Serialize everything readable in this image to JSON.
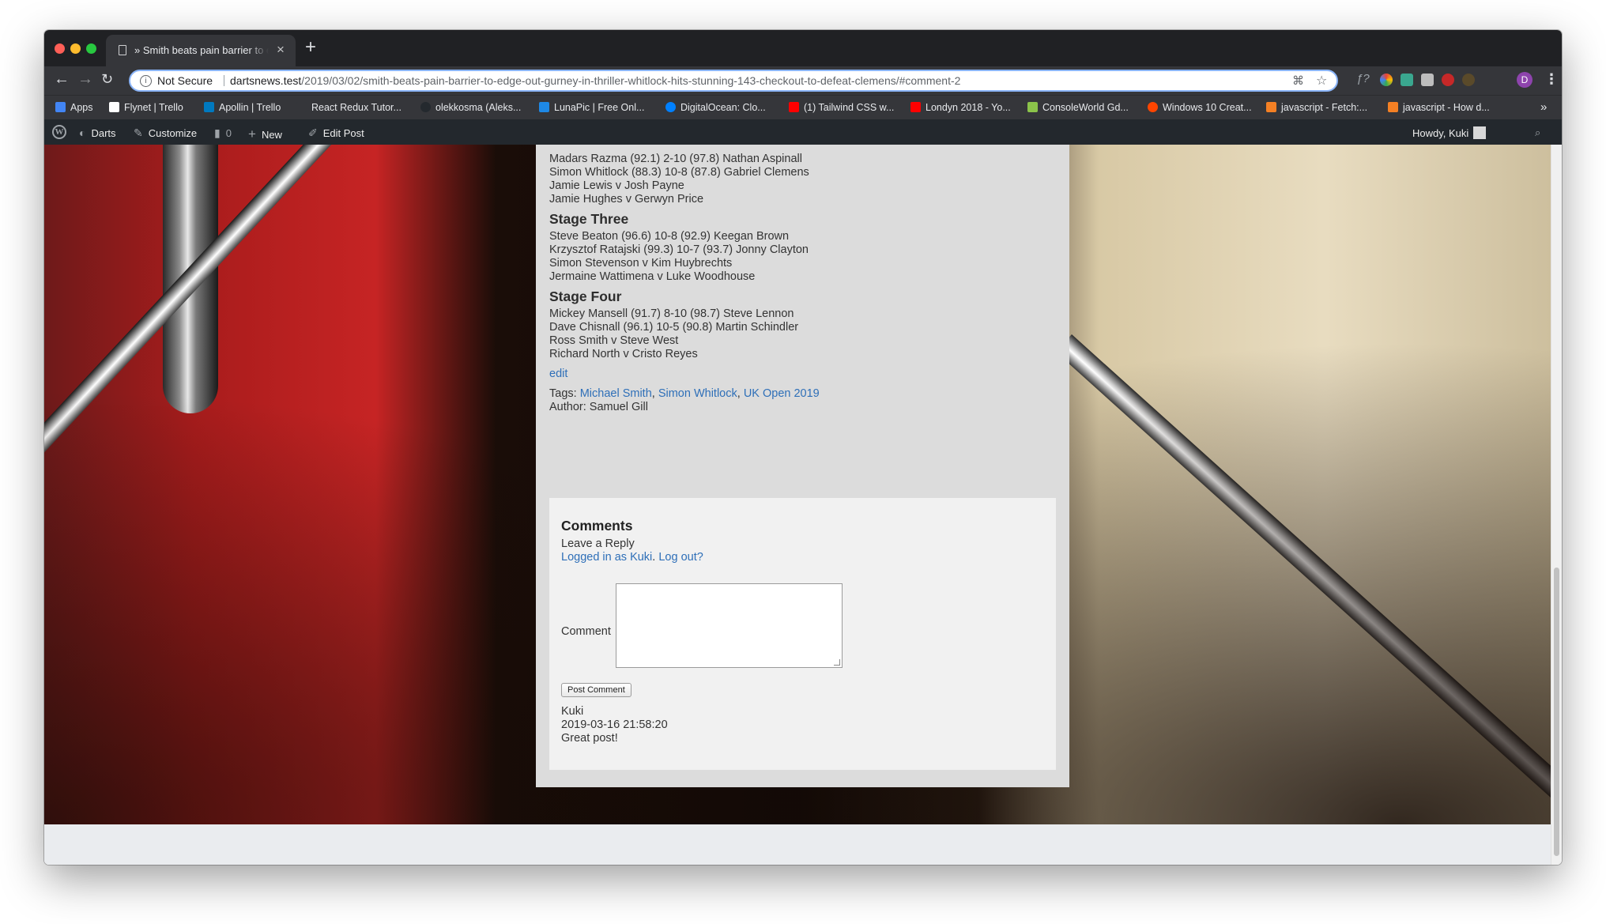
{
  "browser": {
    "tab_title": "» Smith beats pain barrier to edge out Gurney in thriller",
    "new_tab_icon": "+",
    "security_label": "Not Secure",
    "url_host": "dartsnews.test",
    "url_path": "/2019/03/02/smith-beats-pain-barrier-to-edge-out-gurney-in-thriller-whitlock-hits-stunning-143-checkout-to-defeat-clemens/#comment-2",
    "profile_initial": "D",
    "bookmarks": [
      {
        "label": "Apps",
        "color": "#4285f4"
      },
      {
        "label": "Flynet | Trello",
        "color": "#ffffff"
      },
      {
        "label": "Apollin | Trello",
        "color": "#0079bf"
      },
      {
        "label": "React Redux Tutor...",
        "color": "#35363a"
      },
      {
        "label": "olekkosma (Aleks...",
        "color": "#24292e"
      },
      {
        "label": "LunaPic | Free Onl...",
        "color": "#1e88e5"
      },
      {
        "label": "DigitalOcean: Clo...",
        "color": "#0080ff"
      },
      {
        "label": "(1) Tailwind CSS w...",
        "color": "#ff0000"
      },
      {
        "label": "Londyn 2018 - Yo...",
        "color": "#ff0000"
      },
      {
        "label": "ConsoleWorld Gd...",
        "color": "#8bc34a"
      },
      {
        "label": "Windows 10 Creat...",
        "color": "#ff4500"
      },
      {
        "label": "javascript - Fetch:...",
        "color": "#f48024"
      },
      {
        "label": "javascript - How d...",
        "color": "#f48024"
      }
    ],
    "bookmarks_more": "»"
  },
  "adminbar": {
    "site": "Darts",
    "customize": "Customize",
    "comments_count": "0",
    "new": "New",
    "edit_post": "Edit Post",
    "howdy": "Howdy, Kuki"
  },
  "article": {
    "results_top": [
      "Madars Razma (92.1) 2-10 (97.8) Nathan Aspinall",
      "Simon Whitlock (88.3) 10-8 (87.8) Gabriel Clemens",
      "Jamie Lewis v Josh Payne",
      "Jamie Hughes v Gerwyn Price"
    ],
    "stage_three": {
      "heading": "Stage Three",
      "results": [
        "Steve Beaton (96.6) 10-8 (92.9) Keegan Brown",
        "Krzysztof Ratajski (99.3) 10-7 (93.7) Jonny Clayton",
        "Simon Stevenson v Kim Huybrechts",
        "Jermaine Wattimena v Luke Woodhouse"
      ]
    },
    "stage_four": {
      "heading": "Stage Four",
      "results": [
        "Mickey Mansell (91.7) 8-10 (98.7) Steve Lennon",
        "Dave Chisnall (96.1) 10-5 (90.8) Martin Schindler",
        "Ross Smith v Steve West",
        "Richard North v Cristo Reyes"
      ]
    },
    "edit_link": "edit",
    "tags_label": "Tags:",
    "tags": [
      "Michael Smith",
      "Simon Whitlock",
      "UK Open 2019"
    ],
    "tag_sep": ", ",
    "author": "Author: Samuel Gill"
  },
  "comments": {
    "title": "Comments",
    "leave_reply": "Leave a Reply",
    "logged_in": "Logged in as Kuki",
    "log_out": "Log out?",
    "comment_label": "Comment",
    "post_button": "Post Comment",
    "entries": [
      {
        "author": "Kuki",
        "date": "2019-03-16 21:58:20",
        "text": "Great post!"
      }
    ]
  }
}
